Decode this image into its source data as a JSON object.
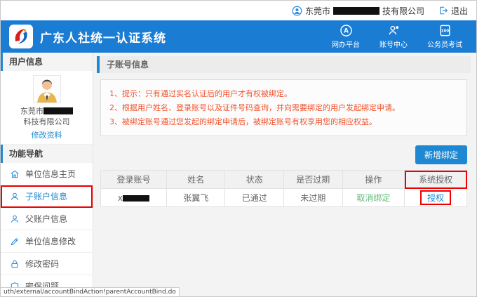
{
  "colors": {
    "header_blue": "#1b7cd4",
    "accent_blue": "#1e88d2",
    "notice_red": "#f0552e",
    "cancel_link_green": "#5fb878",
    "annotation_red": "#ec0000"
  },
  "topbar": {
    "company_prefix": "东莞市",
    "company_suffix": "技有限公司",
    "logout_label": "退出"
  },
  "header": {
    "title": "广东人社统一认证系统",
    "nav": [
      {
        "label": "网办平台",
        "icon": "portal-circle-a-icon"
      },
      {
        "label": "账号中心",
        "icon": "account-person-icon"
      },
      {
        "label": "公务员考试",
        "icon": "exam-document-icon"
      }
    ]
  },
  "sidebar": {
    "user_section_title": "用户信息",
    "company_line1": "东莞市",
    "company_line2": "科技有限公司",
    "edit_profile_label": "修改资料",
    "nav_section_title": "功能导航",
    "items": [
      {
        "label": "单位信息主页",
        "icon": "building-home-icon"
      },
      {
        "label": "子账户信息",
        "icon": "person-icon",
        "highlighted": true
      },
      {
        "label": "父账户信息",
        "icon": "person-icon"
      },
      {
        "label": "单位信息修改",
        "icon": "edit-pencil-icon"
      },
      {
        "label": "修改密码",
        "icon": "lock-icon"
      },
      {
        "label": "密保问题",
        "icon": "shield-icon"
      }
    ]
  },
  "main": {
    "title": "子账号信息",
    "notices": [
      "1、提示：只有通过实名认证后的用户才有权被绑定。",
      "2、根据用户姓名、登录账号以及证件号码查询，并向需要绑定的用户发起绑定申请。",
      "3、被绑定账号通过您发起的绑定申请后，被绑定账号有权享用您的相应权益。"
    ],
    "add_button_label": "新增绑定",
    "table": {
      "headers": [
        "登录账号",
        "姓名",
        "状态",
        "是否过期",
        "操作",
        "系统授权"
      ],
      "rows": [
        {
          "account_prefix": "x",
          "name": "张翼飞",
          "status": "已通过",
          "expired": "未过期",
          "action_label": "取消绑定",
          "authorize_label": "授权"
        }
      ]
    }
  },
  "statusbar": {
    "url": "uth/external/accountBindAction!parentAccountBind.do"
  }
}
